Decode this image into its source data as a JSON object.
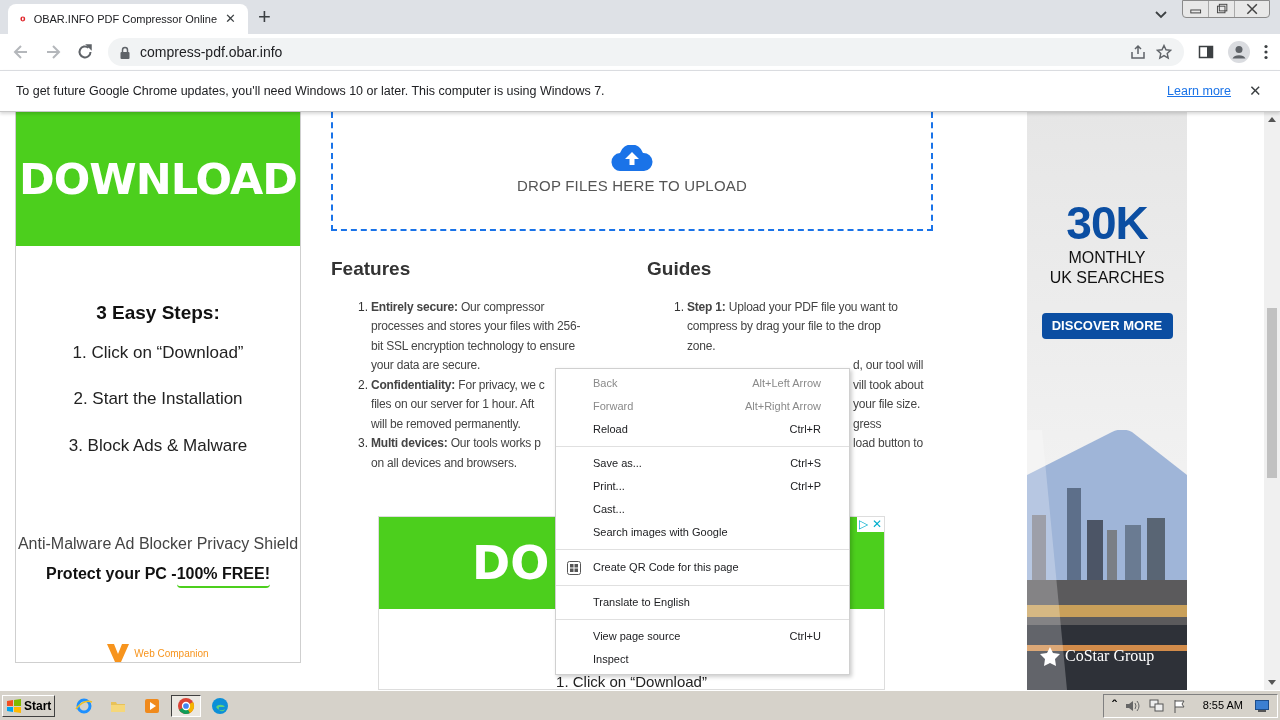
{
  "browser": {
    "tab": {
      "title": "OBAR.INFO PDF Compressor Online",
      "close": "✕"
    },
    "new_tab": "+",
    "nav": [
      {
        "kind": "back",
        "disabled": true
      },
      {
        "kind": "forward",
        "disabled": true
      },
      {
        "kind": "reload",
        "disabled": false
      }
    ],
    "url": "compress-pdf.obar.info"
  },
  "infobar": {
    "message": "To get future Google Chrome updates, you'll need Windows 10 or later. This computer is using Windows 7.",
    "link": "Learn more",
    "close": "✕"
  },
  "left_ad": {
    "banner": "DOWNLOAD",
    "heading": "3 Easy Steps:",
    "steps": [
      "1. Click on “Download”",
      "2. Start the Installation",
      "3. Block Ads & Malware"
    ],
    "tagline": "Anti-Malware Ad Blocker Privacy Shield",
    "protect_lead": "Protect your PC - ",
    "protect_highlight": "100% FREE!",
    "brand": "Web Companion"
  },
  "dropzone": {
    "label": "DROP FILES HERE TO UPLOAD"
  },
  "features": {
    "heading": "Features",
    "items": [
      {
        "number": "1.",
        "lines": [
          "**Entirely secure:** Our compressor",
          "processes and stores your files with 256-",
          "bit SSL encryption technology to ensure",
          "your data are secure."
        ]
      },
      {
        "number": "2.",
        "lines": [
          "**Confidentiality:** For privacy, we c",
          "files on our server for 1 hour. Aft",
          "will be removed permanently."
        ]
      },
      {
        "number": "3.",
        "lines": [
          "**Multi devices:** Our tools works p",
          "on all devices and browsers."
        ]
      }
    ]
  },
  "guides": {
    "heading": "Guides",
    "items": [
      {
        "number": "1.",
        "lines": [
          "**Step 1:** Upload your PDF file you want to",
          "compress by drag your file to the drop",
          "zone."
        ]
      }
    ],
    "covered_lines": [
      "d, our tool will",
      "vill took about",
      "your file size.",
      "gress",
      "load button to"
    ]
  },
  "bottom_ad": {
    "banner": "DO",
    "adchoices": "▷",
    "close": "✕",
    "step": "1. Click on “Download”"
  },
  "right_ad": {
    "figure": "30K",
    "line_1": "MONTHLY",
    "line_2": "UK SEARCHES",
    "button": "DISCOVER MORE",
    "brand": "CoStar Group"
  },
  "context_menu": [
    {
      "kind": "item",
      "label": "Back",
      "shortcut": "Alt+Left Arrow",
      "disabled": true
    },
    {
      "kind": "item",
      "label": "Forward",
      "shortcut": "Alt+Right Arrow",
      "disabled": true
    },
    {
      "kind": "item",
      "label": "Reload",
      "shortcut": "Ctrl+R",
      "disabled": false
    },
    {
      "kind": "separator"
    },
    {
      "kind": "item",
      "label": "Save as...",
      "shortcut": "Ctrl+S",
      "disabled": false
    },
    {
      "kind": "item",
      "label": "Print...",
      "shortcut": "Ctrl+P",
      "disabled": false
    },
    {
      "kind": "item",
      "label": "Cast...",
      "disabled": false
    },
    {
      "kind": "item",
      "label": "Search images with Google",
      "disabled": false
    },
    {
      "kind": "separator"
    },
    {
      "kind": "qr",
      "label": "Create QR Code for this page",
      "disabled": false
    },
    {
      "kind": "separator"
    },
    {
      "kind": "item",
      "label": "Translate to English",
      "disabled": false
    },
    {
      "kind": "separator"
    },
    {
      "kind": "item",
      "label": "View page source",
      "shortcut": "Ctrl+U",
      "disabled": false
    },
    {
      "kind": "item",
      "label": "Inspect",
      "disabled": false
    }
  ],
  "taskbar": {
    "start": "Start",
    "apps": [
      {
        "kind": "ie",
        "selected": false
      },
      {
        "kind": "folder",
        "selected": false
      },
      {
        "kind": "media",
        "selected": false
      },
      {
        "kind": "chrome",
        "selected": true
      },
      {
        "kind": "edge",
        "selected": false
      }
    ],
    "tray_toggle": "ˆ",
    "clock": "8:55 AM"
  }
}
